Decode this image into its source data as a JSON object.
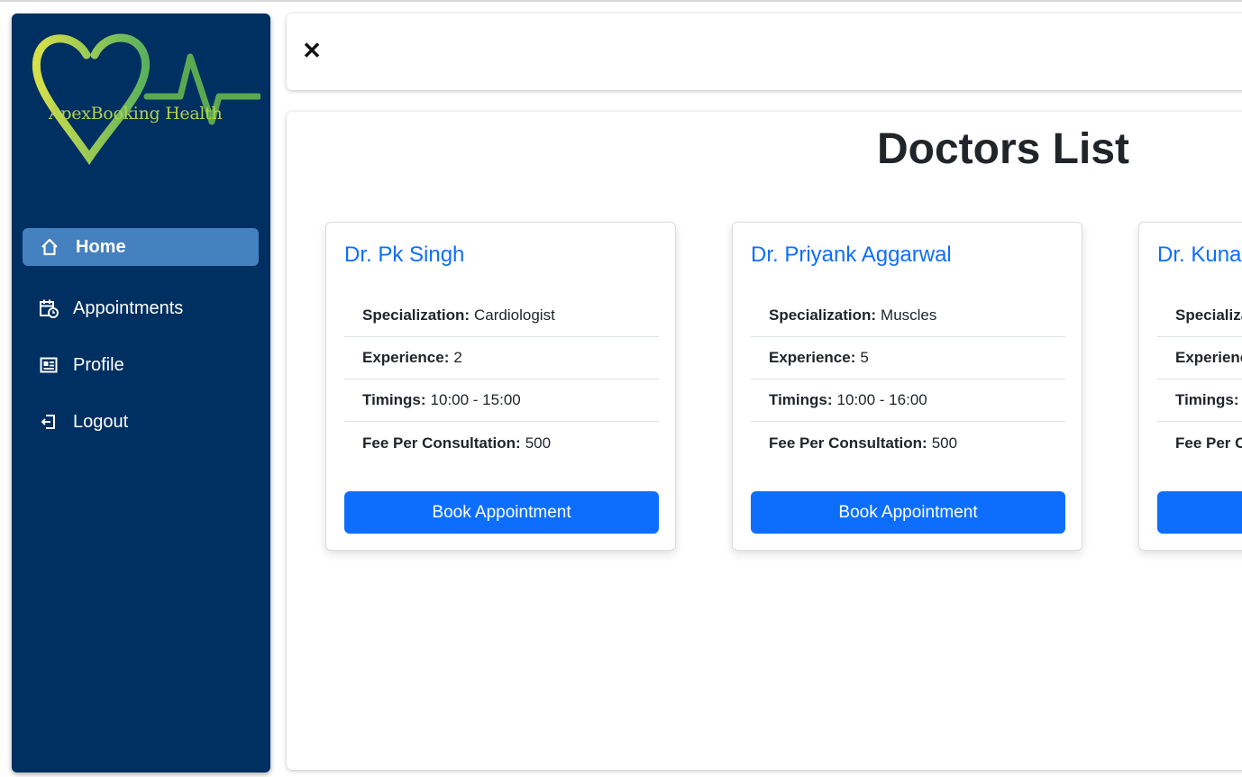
{
  "brand": {
    "name": "ApexBooking Health",
    "logo_color": "#b5cf4a"
  },
  "sidebar": {
    "items": [
      {
        "label": "Home",
        "icon": "home-icon",
        "active": true
      },
      {
        "label": "Appointments",
        "icon": "calendar-clock-icon",
        "active": false
      },
      {
        "label": "Profile",
        "icon": "id-card-icon",
        "active": false
      },
      {
        "label": "Logout",
        "icon": "logout-icon",
        "active": false
      }
    ]
  },
  "header": {
    "close_label": "✕"
  },
  "main": {
    "title": "Doctors List",
    "doctors": [
      {
        "name": "Dr. Pk Singh",
        "specialization_label": "Specialization:",
        "specialization": "Cardiologist",
        "experience_label": "Experience:",
        "experience": "2",
        "timings_label": "Timings:",
        "timings": "10:00 - 15:00",
        "fee_label": "Fee Per Consultation:",
        "fee": "500",
        "button": "Book Appointment"
      },
      {
        "name": "Dr. Priyank Aggarwal",
        "specialization_label": "Specialization:",
        "specialization": "Muscles",
        "experience_label": "Experience:",
        "experience": "5",
        "timings_label": "Timings:",
        "timings": "10:00 - 16:00",
        "fee_label": "Fee Per Consultation:",
        "fee": "500",
        "button": "Book Appointment"
      },
      {
        "name": "Dr. Kuna",
        "specialization_label": "Specializa",
        "experience_label": "Experienc",
        "timings_label": "Timings:",
        "fee_label": "Fee Per C",
        "button": ""
      }
    ]
  },
  "colors": {
    "sidebar_bg": "#002f61",
    "active_bg": "#4580bf",
    "primary": "#0d6efd"
  }
}
